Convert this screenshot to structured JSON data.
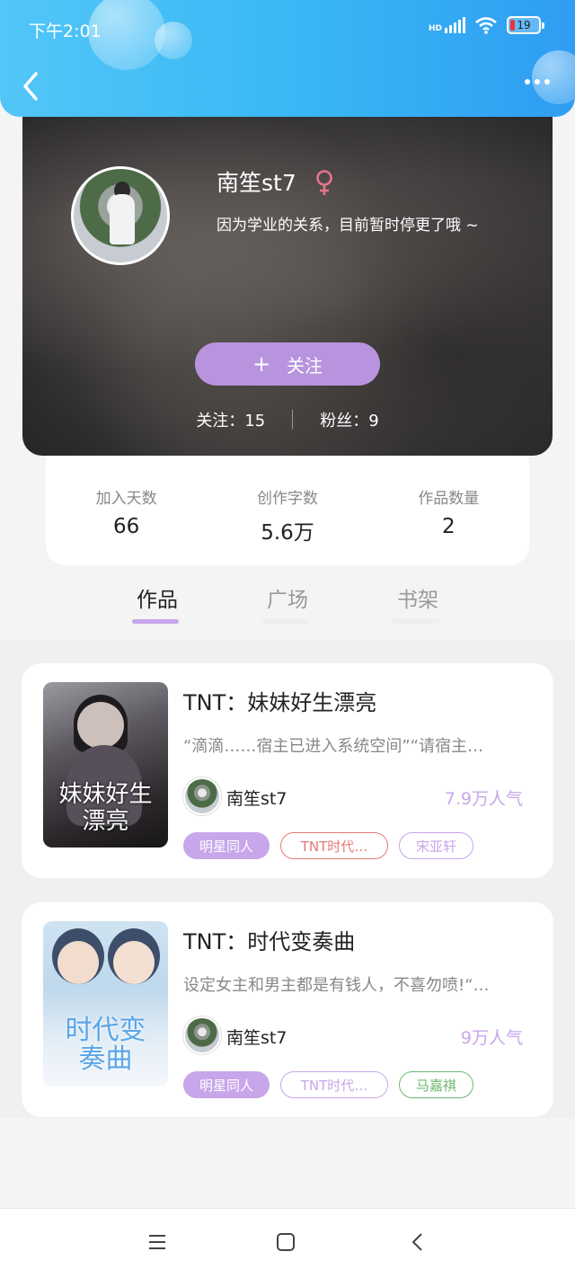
{
  "status_bar": {
    "time": "下午2:01",
    "network": "HD",
    "battery": "19"
  },
  "profile": {
    "name": "南笙st7",
    "bio": "因为学业的关系，目前暂时停更了哦 ~",
    "follow_label": "关注",
    "following": "关注：15",
    "fans": "粉丝：9"
  },
  "counters": [
    {
      "label": "加入天数",
      "value": "66"
    },
    {
      "label": "创作字数",
      "value": "5.6万"
    },
    {
      "label": "作品数量",
      "value": "2"
    }
  ],
  "tabs": [
    {
      "label": "作品",
      "active": true
    },
    {
      "label": "广场",
      "active": false
    },
    {
      "label": "书架",
      "active": false
    }
  ],
  "works": [
    {
      "title": "TNT：妹妹好生漂亮",
      "summary": "“滴滴……宿主已进入系统空间”“请宿主…",
      "author": "南笙st7",
      "popularity": "7.9万人气",
      "cover_text": "妹妹好生漂亮",
      "tags": [
        {
          "label": "明星同人",
          "color": "#c7a6ea"
        },
        {
          "label": "TNT时代…",
          "color": "#e57a74"
        },
        {
          "label": "宋亚轩",
          "color": "#c7a6ea"
        }
      ]
    },
    {
      "title": "TNT：时代变奏曲",
      "summary": "设定女主和男主都是有钱人，不喜勿喷!“…",
      "author": "南笙st7",
      "popularity": "9万人气",
      "cover_text": "时代变奏曲",
      "tags": [
        {
          "label": "明星同人",
          "color": "#c7a6ea"
        },
        {
          "label": "TNT时代…",
          "color": "#c7a6ea"
        },
        {
          "label": "马嘉祺",
          "color": "#6cb86f"
        }
      ]
    }
  ],
  "colors": {
    "accent": "#c7a6ea",
    "follow_button": "#b894de",
    "topbar": "#3ab8f5",
    "female": "#e8738a"
  },
  "icons": [
    "back-icon",
    "more-icon",
    "female-icon",
    "plus-icon",
    "menu-icon",
    "home-icon",
    "nav-back-icon"
  ]
}
